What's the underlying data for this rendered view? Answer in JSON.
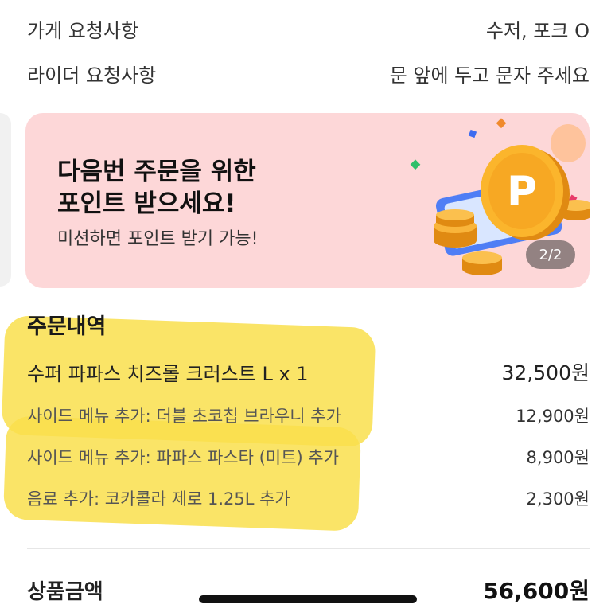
{
  "requests": {
    "store": {
      "label": "가게 요청사항",
      "value": "수저, 포크 O"
    },
    "rider": {
      "label": "라이더 요청사항",
      "value": "문 앞에 두고 문자 주세요"
    }
  },
  "banner": {
    "title_line1": "다음번 주문을 위한",
    "title_line2": "포인트 받으세요!",
    "subtitle": "미션하면 포인트 받기 가능!",
    "page_indicator": "2/2",
    "coin_letter": "P",
    "bg_color": "#fdd7d8"
  },
  "order": {
    "section_title": "주문내역",
    "main_item": {
      "name": "수퍼 파파스 치즈롤 크러스트 L x 1",
      "price": "32,500원"
    },
    "options": [
      {
        "name": "사이드 메뉴 추가: 더블 초코칩 브라우니 추가",
        "price": "12,900원"
      },
      {
        "name": "사이드 메뉴 추가: 파파스 파스타 (미트) 추가",
        "price": "8,900원"
      },
      {
        "name": "음료 추가: 코카콜라 제로 1.25L 추가",
        "price": "2,300원"
      }
    ]
  },
  "total": {
    "label": "상품금액",
    "value": "56,600원"
  },
  "colors": {
    "highlight": "#f9df4c",
    "coin": "#f7a823"
  }
}
